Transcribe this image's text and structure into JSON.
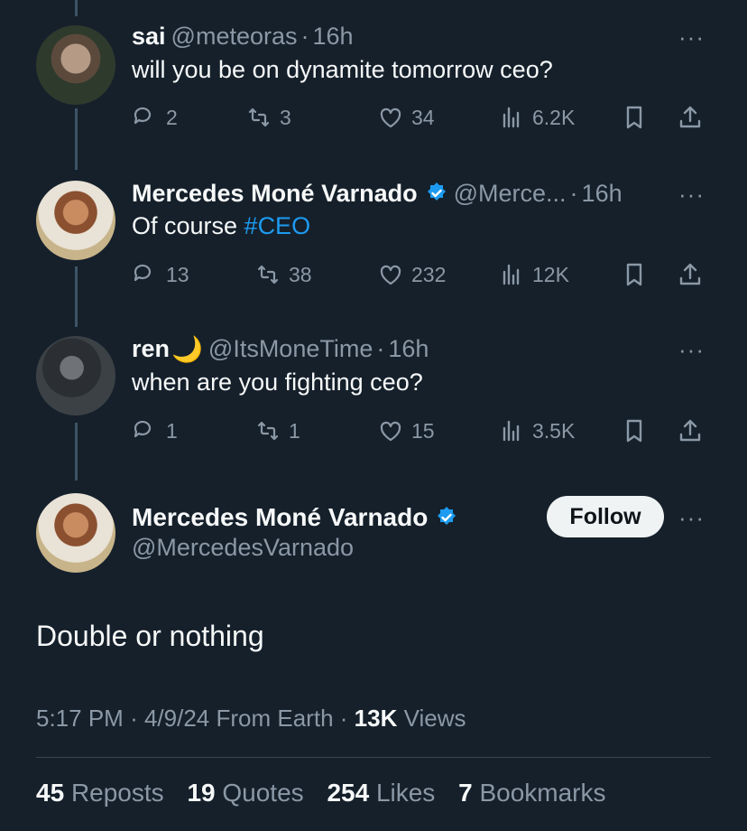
{
  "replies": [
    {
      "name": "sai",
      "handle": "@meteoras",
      "time": "16h",
      "text": "will you be on dynamite tomorrow ceo?",
      "replies": "2",
      "reposts": "3",
      "likes": "34",
      "views": "6.2K"
    },
    {
      "name": "Mercedes Moné Varnado",
      "handle": "@Merce...",
      "time": "16h",
      "text_prefix": "Of course ",
      "hashtag": "#CEO",
      "replies": "13",
      "reposts": "38",
      "likes": "232",
      "views": "12K"
    },
    {
      "name": "ren",
      "handle": "@ItsMoneTime",
      "time": "16h",
      "text": "when are you fighting ceo?",
      "replies": "1",
      "reposts": "1",
      "likes": "15",
      "views": "3.5K"
    }
  ],
  "main": {
    "name": "Mercedes Moné Varnado",
    "handle": "@MercedesVarnado",
    "follow_label": "Follow",
    "text": "Double or nothing",
    "time": "5:17 PM",
    "date": "4/9/24",
    "source": "From Earth",
    "views_count": "13K",
    "views_label": "Views",
    "stats": [
      {
        "count": "45",
        "label": "Reposts"
      },
      {
        "count": "19",
        "label": "Quotes"
      },
      {
        "count": "254",
        "label": "Likes"
      },
      {
        "count": "7",
        "label": "Bookmarks"
      }
    ]
  },
  "separator": "·",
  "more_glyph": "···",
  "moon_glyph": "🌙",
  "colors": {
    "background": "#15202b",
    "link": "#1d9bf0",
    "muted": "#8b98a5",
    "verified": "#1d9bf0"
  },
  "icons": [
    "reply-icon",
    "repost-icon",
    "like-icon",
    "views-icon",
    "bookmark-icon",
    "share-icon",
    "verified-badge-icon",
    "more-icon"
  ]
}
